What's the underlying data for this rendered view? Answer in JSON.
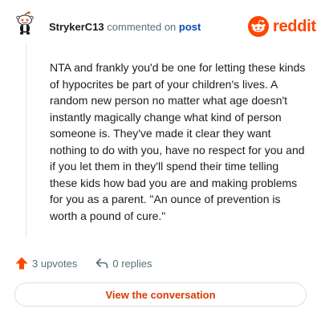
{
  "header": {
    "username": "StrykerC13",
    "action": "commented on",
    "post_link": "post"
  },
  "logo": {
    "wordmark": "reddit",
    "icon": "reddit-snoo-icon"
  },
  "comment": {
    "text": "NTA and frankly you'd be one for letting these kinds of hypocrites be part of your children's lives. A random new person no matter what age doesn't instantly magically change what kind of person someone is. They've made it clear they want nothing to do with you, have no respect for you and if you let them in they'll spend their time telling these kids how bad you are and making problems for you as a parent. \"An ounce of prevention is worth a pound of cure.\""
  },
  "footer": {
    "upvotes": "3 upvotes",
    "upvote_icon": "upvote-arrow-icon",
    "replies": "0 replies",
    "reply_icon": "reply-arrow-icon"
  },
  "cta": {
    "label": "View the conversation"
  },
  "colors": {
    "brand": "#ff4500",
    "link": "#0a4bb5",
    "muted": "#576f76",
    "cta_text": "#d93a00"
  }
}
